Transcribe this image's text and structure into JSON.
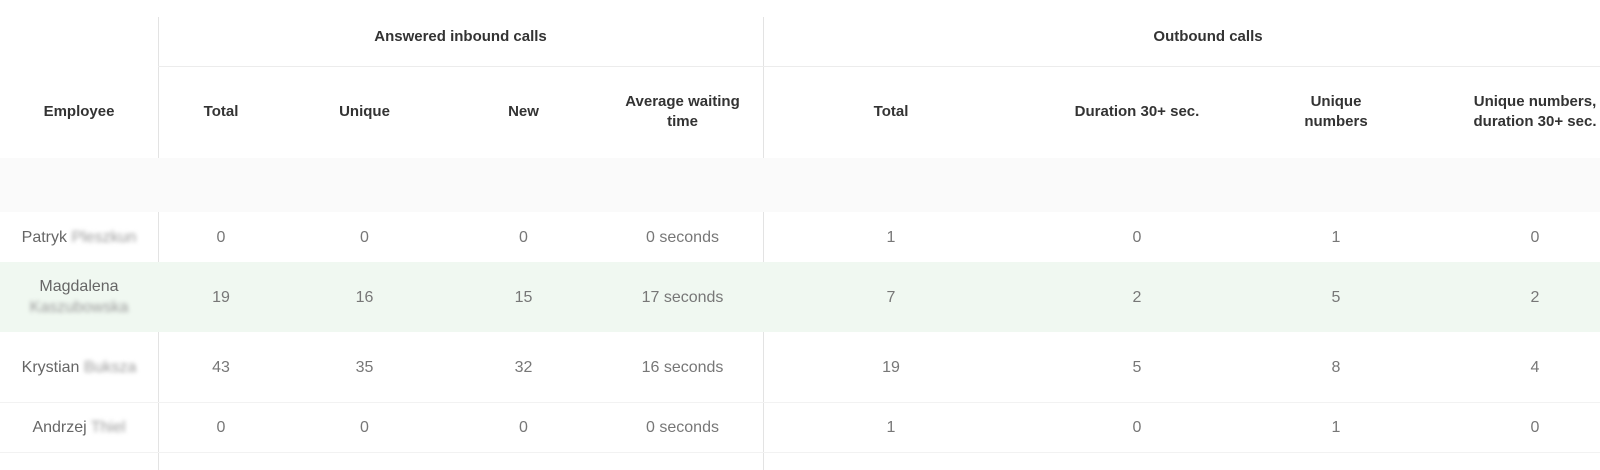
{
  "header": {
    "employee_label": "Employee",
    "groups": [
      {
        "label": "Answered inbound calls"
      },
      {
        "label": "Outbound calls"
      }
    ],
    "columns": [
      {
        "label": "Total"
      },
      {
        "label": "Unique"
      },
      {
        "label": "New"
      },
      {
        "label": "Average waiting time"
      },
      {
        "label": "Total"
      },
      {
        "label": "Duration 30+ sec."
      },
      {
        "label": "Unique numbers"
      },
      {
        "label": "Unique numbers, duration 30+ sec."
      }
    ]
  },
  "rows": [
    {
      "first": "Patryk",
      "last": "Pleszkun",
      "values": [
        "0",
        "0",
        "0",
        "0 seconds",
        "1",
        "0",
        "1",
        "0"
      ],
      "highlighted": false
    },
    {
      "first": "Magdalena",
      "last": "Kaszubowska",
      "values": [
        "19",
        "16",
        "15",
        "17 seconds",
        "7",
        "2",
        "5",
        "2"
      ],
      "highlighted": true
    },
    {
      "first": "Krystian",
      "last": "Buksza",
      "values": [
        "43",
        "35",
        "32",
        "16 seconds",
        "19",
        "5",
        "8",
        "4"
      ],
      "highlighted": false
    },
    {
      "first": "Andrzej",
      "last": "Thiel",
      "values": [
        "0",
        "0",
        "0",
        "0 seconds",
        "1",
        "0",
        "1",
        "0"
      ],
      "highlighted": false
    }
  ],
  "colors": {
    "highlight_row": "#f0f8f1",
    "border": "#e3e3e3"
  }
}
